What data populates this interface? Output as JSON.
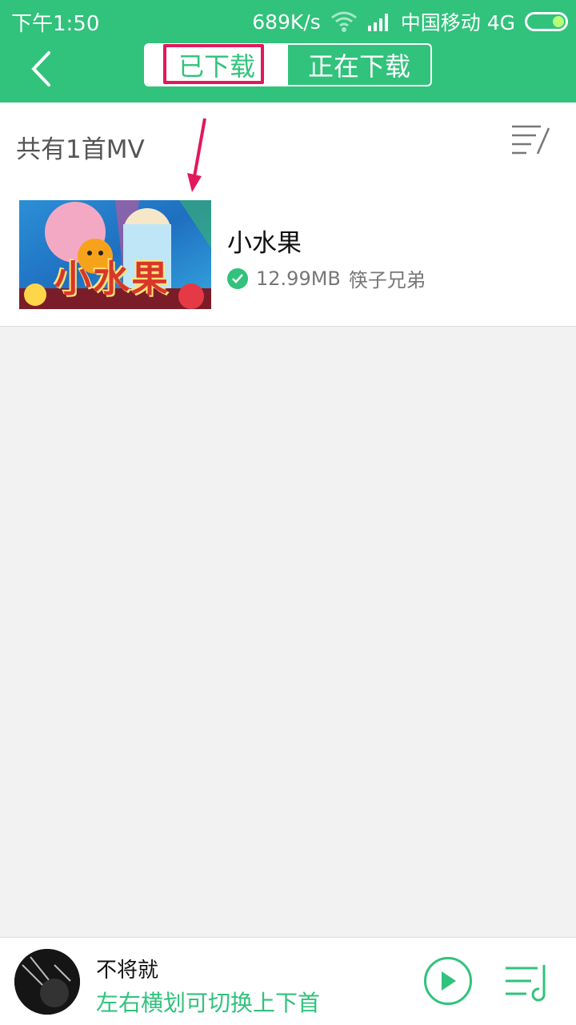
{
  "status": {
    "time": "下午1:50",
    "speed": "689K/s",
    "carrier": "中国移动 4G"
  },
  "nav": {
    "tabs": [
      {
        "label": "已下载",
        "active": true
      },
      {
        "label": "正在下载",
        "active": false
      }
    ]
  },
  "list": {
    "count_text": "共有1首MV",
    "items": [
      {
        "title": "小水果",
        "size": "12.99MB",
        "artist": "筷子兄弟",
        "thumb_text": "小水果",
        "downloaded": true
      }
    ]
  },
  "player": {
    "now_playing": "不将就",
    "hint": "左右横划可切换上下首"
  },
  "colors": {
    "accent": "#31c27c",
    "highlight": "#e2185b"
  }
}
